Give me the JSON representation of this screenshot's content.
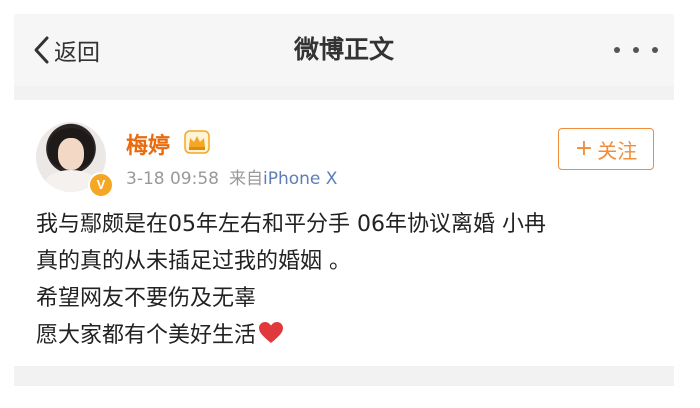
{
  "navbar": {
    "back_label": "返回",
    "title": "微博正文"
  },
  "post": {
    "username": "梅婷",
    "timestamp": "3-18 09:58",
    "source_prefix": "来自",
    "device": "iPhone X",
    "follow_label": "关注",
    "lines": [
      "我与鄢颇是在05年左右和平分手  06年协议离婚 小冉",
      "真的真的从未插足过我的婚姻 。",
      "希望网友不要伤及无辜",
      "愿大家都有个美好生活"
    ],
    "verified_badge": "V"
  },
  "colors": {
    "accent": "#e86b0f",
    "follow": "#f08c3a",
    "link": "#5b7fb5",
    "heart": "#e0383c",
    "verified": "#f5a623"
  },
  "icons": {
    "back": "chevron-left-icon",
    "more": "more-dots-icon",
    "crown": "crown-icon",
    "heart": "heart-icon",
    "verified": "verified-badge-icon"
  }
}
